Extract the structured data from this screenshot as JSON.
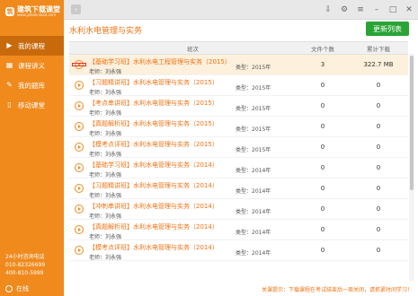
{
  "app": {
    "name": "建筑下载课堂",
    "url": "www.jzdownload.com"
  },
  "sidebar": {
    "items": [
      {
        "label": "我的课程",
        "icon": "play-circle-icon",
        "active": true
      },
      {
        "label": "课程讲义",
        "icon": "grid-icon",
        "active": false
      },
      {
        "label": "我的题库",
        "icon": "edit-icon",
        "active": false
      },
      {
        "label": "移动课堂",
        "icon": "mobile-icon",
        "active": false
      }
    ],
    "hotline_label": "24小时咨询电话",
    "phone1": "010-82326699",
    "phone2": "400-810-5999",
    "status": "在线"
  },
  "topbar": {
    "icons": [
      "download-icon",
      "gear-icon",
      "menu-icon",
      "minimize-icon",
      "maximize-icon",
      "close-icon"
    ]
  },
  "page": {
    "title": "水利水电管理与实务",
    "update_button": "更新列表"
  },
  "table": {
    "headers": {
      "name": "班次",
      "files": "文件个数",
      "downloads": "累计下载"
    },
    "rows": [
      {
        "title": "【基础学习班】水利水电工程管理与实务（2015）",
        "teacher": "老师：刘永强",
        "type": "类型：2015年",
        "files": "3",
        "downloads": "322.7 MB"
      },
      {
        "title": "【习题精讲班】水利水电管理与实务（2015）",
        "teacher": "老师：刘永强",
        "type": "类型：2015年",
        "files": "0",
        "downloads": "0"
      },
      {
        "title": "【考点串讲班】水利水电管理与实务（2015）",
        "teacher": "老师：刘永强",
        "type": "类型：2015年",
        "files": "0",
        "downloads": "0"
      },
      {
        "title": "【真题解析班】水利水电管理与实务（2015）",
        "teacher": "老师：刘永强",
        "type": "类型：2015年",
        "files": "0",
        "downloads": "0"
      },
      {
        "title": "【模考点评班】水利水电管理与实务（2015）",
        "teacher": "老师：刘永强",
        "type": "类型：2015年",
        "files": "0",
        "downloads": "0"
      },
      {
        "title": "【基础学习班】水利水电管理与实务（2014）",
        "teacher": "老师：刘永强",
        "type": "类型：2014年",
        "files": "0",
        "downloads": "0"
      },
      {
        "title": "【习题精讲班】水利水电管理与实务（2014）",
        "teacher": "老师：刘永强",
        "type": "类型：2014年",
        "files": "0",
        "downloads": "0"
      },
      {
        "title": "【冲刺串讲班】水利水电管理与实务（2014）",
        "teacher": "老师：刘永强",
        "type": "类型：2014年",
        "files": "0",
        "downloads": "0"
      },
      {
        "title": "【真题解析班】水利水电管理与实务（2014）",
        "teacher": "老师：刘永强",
        "type": "类型：2014年",
        "files": "0",
        "downloads": "0"
      },
      {
        "title": "【模考点评班】水利水电管理与实务（2014）",
        "teacher": "老师：刘永强",
        "type": "类型：2014年",
        "files": "0",
        "downloads": "0"
      },
      {
        "title": "",
        "teacher": "",
        "type": "",
        "files": "",
        "downloads": ""
      }
    ]
  },
  "notice": "关课提示：下载课程在考试结束后一周关闭，请抓紧时间学习！",
  "colors": {
    "accent": "#f08a1d",
    "sidebar_active": "#c86a0c",
    "update_button": "#2aa335",
    "title": "#f07010",
    "selected_row": "#fdf0dc"
  }
}
